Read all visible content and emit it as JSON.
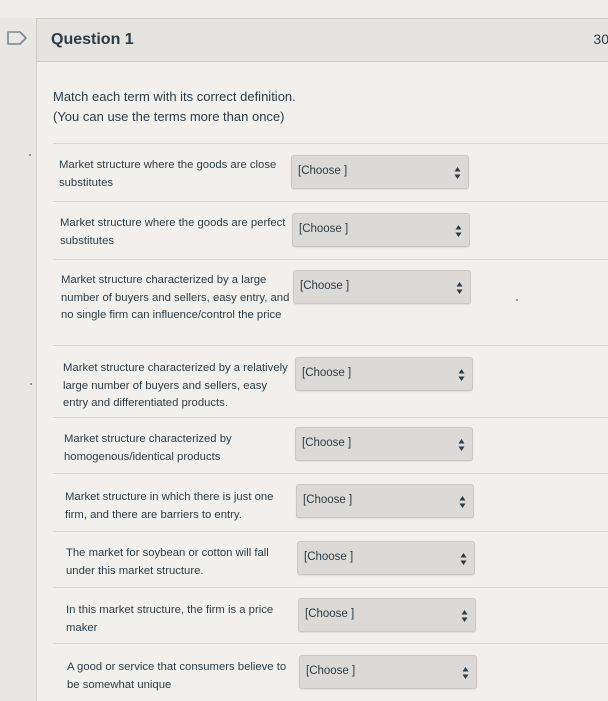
{
  "question": {
    "title": "Question 1",
    "points": "30",
    "prompt_line1": "Match each term with its correct definition.",
    "prompt_line2": "(You can use the terms more than once)"
  },
  "icons": {
    "flag": "bookmark-flag-icon",
    "dropdown": "up-down-arrows-icon"
  },
  "colors": {
    "card_bg": "#f1f0ec",
    "header_bg": "#e4e3df",
    "select_bg": "#dcdad6",
    "text": "#2d3b45"
  },
  "rows": [
    {
      "term": "Market structure where the goods are close substitutes",
      "selected": "[Choose ]"
    },
    {
      "term": "Market structure where the goods are perfect substitutes",
      "selected": "[Choose ]"
    },
    {
      "term": "Market structure characterized by a large number of buyers and sellers, easy entry, and no single firm can influence/control the price",
      "selected": "[Choose ]"
    },
    {
      "term": "Market structure characterized by a relatively large number of buyers and sellers, easy entry and differentiated products.",
      "selected": "[Choose ]"
    },
    {
      "term": "Market structure characterized by homogenous/identical products",
      "selected": "[Choose ]"
    },
    {
      "term": "Market structure in which there is just one firm, and there are barriers to entry.",
      "selected": "[Choose ]"
    },
    {
      "term": "The market for soybean or cotton will fall under this market structure.",
      "selected": "[Choose ]"
    },
    {
      "term": "In this market structure, the firm is a price maker",
      "selected": "[Choose ]"
    },
    {
      "term": "A good or service that consumers believe to be somewhat unique",
      "selected": "[Choose ]"
    }
  ]
}
